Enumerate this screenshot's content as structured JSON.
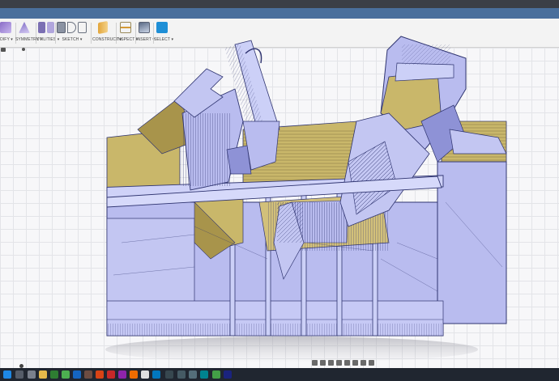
{
  "window": {
    "title": ""
  },
  "toolbar": {
    "groups": [
      {
        "label": "DIFY ▾",
        "icon": "modify-icon"
      },
      {
        "label": "SYMMETRY ▾",
        "icon": "symmetry-icon"
      },
      {
        "label": "UTILITIES ▾",
        "icon": "utilities-icon"
      },
      {
        "label": "SKETCH ▾",
        "icon": "sketch-icon"
      },
      {
        "label": "CONSTRUCT ▾",
        "icon": "construct-icon"
      },
      {
        "label": "INSPECT ▾",
        "icon": "inspect-icon"
      },
      {
        "label": "INSERT ▾",
        "icon": "insert-icon"
      },
      {
        "label": "SELECT ▾",
        "icon": "select-icon"
      }
    ]
  },
  "colors": {
    "model_fill": "#b9bcef",
    "model_dark": "#8e92d6",
    "model_tan": "#c9b76a",
    "model_tan_dark": "#a8944b",
    "edge": "#2f3470",
    "accent_blue": "#1f8fd6"
  },
  "taskbar": {
    "items": [
      "windows-start-icon",
      "search-icon",
      "task-view-icon",
      "explorer-icon",
      "mail-icon",
      "excel-icon",
      "chrome-icon",
      "paint-icon",
      "media-icon",
      "fusion-icon",
      "mixer-icon",
      "settings-icon",
      "word-icon",
      "calculator-icon",
      "steam-icon",
      "photoshop-icon"
    ]
  }
}
